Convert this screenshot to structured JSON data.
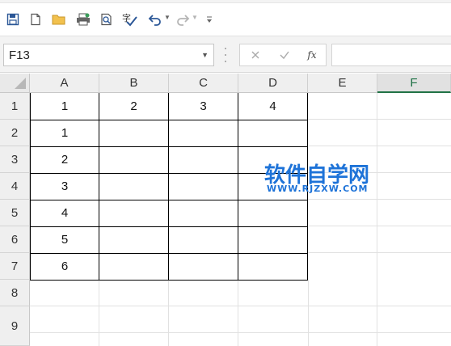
{
  "toolbar": {
    "icons": [
      "save-icon",
      "new-file-icon",
      "open-folder-icon",
      "print-icon",
      "print-preview-icon",
      "spellcheck-icon",
      "undo-icon",
      "redo-icon",
      "customize-icon"
    ],
    "spell_label": "字"
  },
  "formula_bar": {
    "name_box": "F13",
    "fx_label": "fx",
    "formula": ""
  },
  "sheet": {
    "columns": [
      "A",
      "B",
      "C",
      "D",
      "E",
      "F"
    ],
    "selected_column": "F",
    "rows": [
      "1",
      "2",
      "3",
      "4",
      "5",
      "6",
      "7",
      "8",
      "9"
    ],
    "cells": {
      "A1": "1",
      "B1": "2",
      "C1": "3",
      "D1": "4",
      "A2": "1",
      "A3": "2",
      "A4": "3",
      "A5": "4",
      "A6": "5",
      "A7": "6"
    }
  },
  "watermark": {
    "title": "软件自学网",
    "url": "WWW.RJZXW.COM",
    "color": "#1e73d8"
  },
  "colors": {
    "accent": "#217346",
    "header_bg": "#efefef"
  }
}
